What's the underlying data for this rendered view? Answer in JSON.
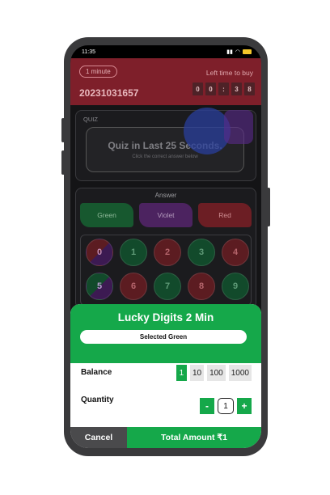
{
  "status_bar": {
    "time": "11:35"
  },
  "period": {
    "pill_label": "1 minute",
    "id": "20231031657",
    "left_time_label": "Left time to buy",
    "timer_digits": [
      "0",
      "0",
      ":",
      "3",
      "8"
    ]
  },
  "quiz": {
    "label": "QUIZ",
    "title": "Quiz in Last 25 Seconds.",
    "subtitle": "Click the correct answer below"
  },
  "answer": {
    "label": "Answer",
    "colors": [
      {
        "label": "Green",
        "color": "#17582f"
      },
      {
        "label": "Violet",
        "color": "#4c2360"
      },
      {
        "label": "Red",
        "color": "#6c1e24"
      }
    ],
    "digits": [
      "0",
      "1",
      "2",
      "3",
      "4",
      "5",
      "6",
      "7",
      "8",
      "9"
    ]
  },
  "sheet": {
    "title": "Lucky Digits 2 Min",
    "selected": "Selected Green",
    "balance_label": "Balance",
    "balance_options": [
      "1",
      "10",
      "100",
      "1000"
    ],
    "quantity_label": "Quantity",
    "minus": "-",
    "quantity": "1",
    "plus": "+",
    "cancel": "Cancel",
    "total": "Total Amount ₹1",
    "accent": "#15a84a"
  }
}
